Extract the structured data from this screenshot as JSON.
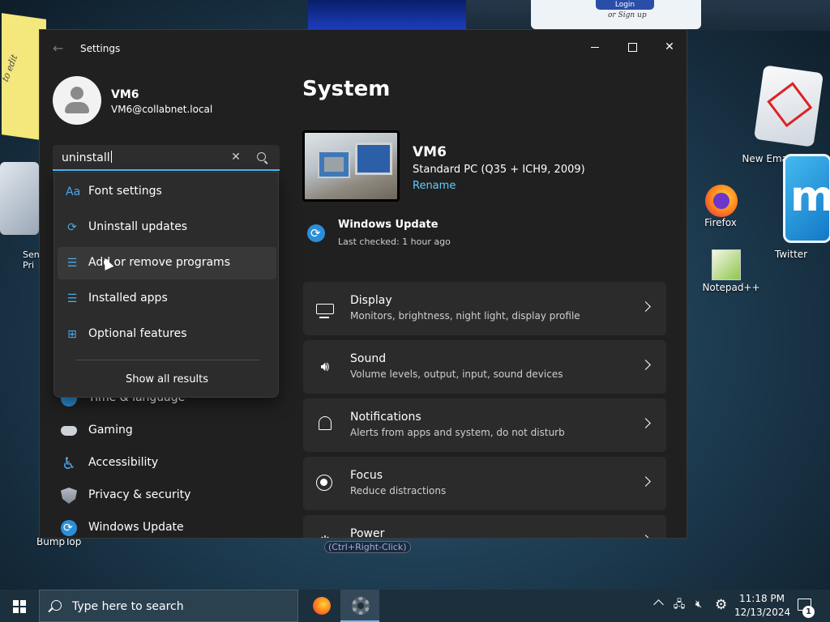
{
  "desktop": {
    "login_label": "Login",
    "login_or": "or Sign up",
    "sticky_text": "to edit",
    "left_icon_label_1": "Sen",
    "left_icon_label_2": "Pri",
    "new_email_label": "New Email",
    "twitter_label": "Twitter",
    "firefox_label": "Firefox",
    "notepad_label": "Notepad++",
    "bumptop_label": "BumpTop",
    "ctrl_hint": "(Ctrl+Right-Click)"
  },
  "window": {
    "title": "Settings",
    "controls": {
      "minimize": "",
      "maximize": "",
      "close": "✕"
    }
  },
  "profile": {
    "name": "VM6",
    "email": "VM6@collabnet.local"
  },
  "search": {
    "value": "uninstall",
    "clear_glyph": "✕"
  },
  "dropdown": {
    "items": [
      {
        "label": "Font settings",
        "icon": "font-icon",
        "glyph": "Aa"
      },
      {
        "label": "Uninstall updates",
        "icon": "refresh-icon",
        "glyph": "⟳"
      },
      {
        "label": "Add or remove programs",
        "icon": "apps-list-icon",
        "glyph": "☰"
      },
      {
        "label": "Installed apps",
        "icon": "apps-list-icon",
        "glyph": "☰"
      },
      {
        "label": "Optional features",
        "icon": "grid-icon",
        "glyph": "⊞"
      }
    ],
    "show_all": "Show all results"
  },
  "nav": {
    "items": [
      {
        "label": "Time & language"
      },
      {
        "label": "Gaming"
      },
      {
        "label": "Accessibility"
      },
      {
        "label": "Privacy & security"
      },
      {
        "label": "Windows Update"
      }
    ]
  },
  "main": {
    "title": "System",
    "device": {
      "name": "VM6",
      "model": "Standard PC (Q35 + ICH9, 2009)",
      "rename": "Rename"
    },
    "update": {
      "title": "Windows Update",
      "status": "Last checked: 1 hour ago"
    },
    "cards": [
      {
        "title": "Display",
        "subtitle": "Monitors, brightness, night light, display profile",
        "icon": "display-icon"
      },
      {
        "title": "Sound",
        "subtitle": "Volume levels, output, input, sound devices",
        "icon": "speaker-icon"
      },
      {
        "title": "Notifications",
        "subtitle": "Alerts from apps and system, do not disturb",
        "icon": "bell-icon"
      },
      {
        "title": "Focus",
        "subtitle": "Reduce distractions",
        "icon": "focus-icon"
      },
      {
        "title": "Power",
        "subtitle": "",
        "icon": "power-icon"
      }
    ]
  },
  "taskbar": {
    "search_placeholder": "Type here to search",
    "time": "11:18 PM",
    "date": "12/13/2024",
    "notification_count": "1"
  },
  "colors": {
    "accent": "#4cc2ff",
    "link": "#60cdff",
    "window_bg": "#202020",
    "card_bg": "#2b2b2b",
    "taskbar_bg": "#1c2f3c"
  }
}
